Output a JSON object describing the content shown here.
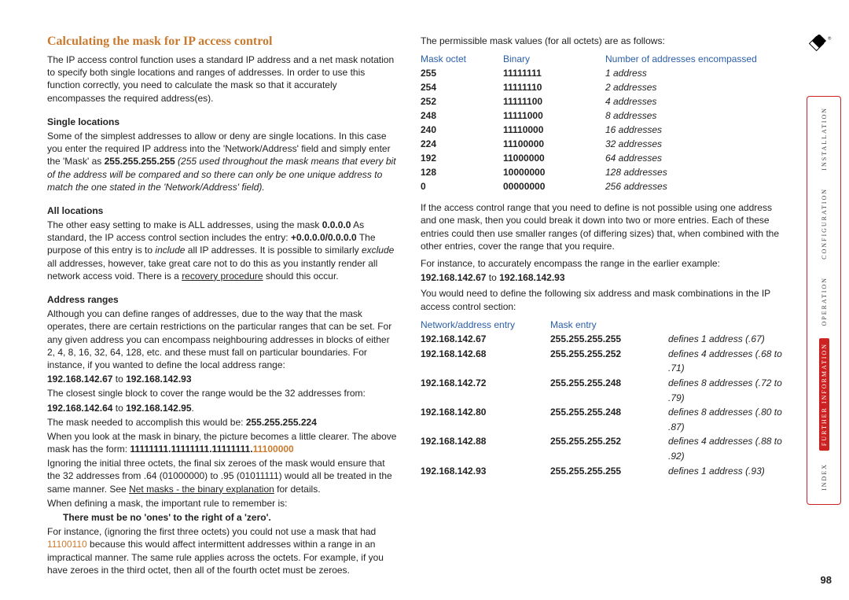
{
  "title": "Calculating the mask for IP access control",
  "pageNumber": "98",
  "intro": "The IP access control function uses a standard IP address and a net mask notation to specify both single locations and ranges of addresses. In order to use this function correctly, you need to calculate the mask so that it accurately encompasses the required address(es).",
  "single": {
    "head": "Single locations",
    "p1a": "Some of the simplest addresses to allow or deny are single locations. In this case you enter the required IP address into the 'Network/Address' field and simply enter the 'Mask' as ",
    "p1b": "255.255.255.255 ",
    "p1c": "(255 used throughout the mask means that every bit of the address will be compared and so there can only be one unique address to match the one stated in the 'Network/Address' field)."
  },
  "all": {
    "head": "All locations",
    "p1a": "The other easy setting to make is ALL addresses, using the mask ",
    "p1b": "0.0.0.0",
    "p1c": "  As standard, the IP access control section includes the entry: ",
    "p1d": "+0.0.0.0/0.0.0.0",
    "p1e": " The purpose of this entry is to ",
    "p1f": "include",
    "p1g": " all IP addresses. It is possible to similarly ",
    "p1h": "exclude",
    "p1i": " all addresses, however, take great care not to do this as you instantly render all network access void. There is a ",
    "p1j": "recovery procedure",
    "p1k": " should this occur."
  },
  "ranges": {
    "head": "Address ranges",
    "p1": "Although you can define ranges of addresses, due to the way that the mask operates, there are certain restrictions on the particular ranges that can be set. For any given address you can encompass neighbouring addresses in blocks of either 2, 4, 8, 16, 32, 64, 128, etc. and these must fall on particular boundaries. For instance, if you wanted to define the local address range:",
    "r1a": "192.168.142.67",
    "r1b": " to ",
    "r1c": "192.168.142.93",
    "p2": "The closest single block to cover the range would be the 32 addresses from:",
    "r2a": "192.168.142.64",
    "r2b": " to ",
    "r2c": "192.168.142.95",
    "r2d": ".",
    "p3a": "The mask needed to accomplish this would be: ",
    "p3b": "255.255.255.224",
    "p4a": "When you look at the mask in binary, the picture becomes a little clearer. The above mask has the form: ",
    "p4b": "11111111.11111111.11111111.",
    "p4c": "11100000",
    "p5a": "Ignoring the initial three octets, the final six zeroes of the mask would ensure that the 32 addresses from .64 (01000000) to .95 (01011111) would all be treated in the same manner. See ",
    "p5b": "Net masks - the binary explanation",
    "p5c": " for details.",
    "p6": "When defining a mask, the important rule to remember is:",
    "rule": "There must be no 'ones' to the right of a 'zero'.",
    "p7a": "For instance, (ignoring the first three octets) you could not use a mask that had ",
    "p7b": "11100110",
    "p7c": " because this would affect intermittent addresses within a range in an impractical manner. The same rule applies across the octets. For example, if you have zeroes in the third octet, then all of the fourth octet must be zeroes."
  },
  "perm": {
    "intro": "The permissible mask values (for all octets) are as follows:",
    "headers": {
      "c1": "Mask octet",
      "c2": "Binary",
      "c3": "Number of addresses encompassed"
    },
    "rows": [
      {
        "c1": "255",
        "c2": "11111111",
        "c3": "1 address"
      },
      {
        "c1": "254",
        "c2": "11111110",
        "c3": "2 addresses"
      },
      {
        "c1": "252",
        "c2": "11111100",
        "c3": "4 addresses"
      },
      {
        "c1": "248",
        "c2": "11111000",
        "c3": "8 addresses"
      },
      {
        "c1": "240",
        "c2": "11110000",
        "c3": "16 addresses"
      },
      {
        "c1": "224",
        "c2": "11100000",
        "c3": "32 addresses"
      },
      {
        "c1": "192",
        "c2": "11000000",
        "c3": "64 addresses"
      },
      {
        "c1": "128",
        "c2": "10000000",
        "c3": "128 addresses"
      },
      {
        "c1": "0",
        "c2": "00000000",
        "c3": "256 addresses"
      }
    ]
  },
  "combine": {
    "p1": "If the access control range that you need to define is not possible using one address and one mask, then you could break it down into two or more entries. Each of these entries could then use smaller ranges (of differing sizes) that, when combined with the other entries, cover the range that you require.",
    "p2": "For instance, to accurately encompass the range in the earlier example:",
    "r1a": "192.168.142.67",
    "r1b": " to ",
    "r1c": "192.168.142.93",
    "p3": "You would need to define the following six address and mask combinations in the IP access control section:",
    "headers": {
      "e1": "Network/address entry",
      "e2": "Mask entry"
    },
    "rows": [
      {
        "e1": "192.168.142.67",
        "e2": "255.255.255.255",
        "e3": "defines 1 address (.67)"
      },
      {
        "e1": "192.168.142.68",
        "e2": "255.255.255.252",
        "e3": "defines 4 addresses (.68 to .71)"
      },
      {
        "e1": "192.168.142.72",
        "e2": "255.255.255.248",
        "e3": "defines 8 addresses (.72 to .79)"
      },
      {
        "e1": "192.168.142.80",
        "e2": "255.255.255.248",
        "e3": "defines 8 addresses (.80 to .87)"
      },
      {
        "e1": "192.168.142.88",
        "e2": "255.255.255.252",
        "e3": "defines 4 addresses (.88 to .92)"
      },
      {
        "e1": "192.168.142.93",
        "e2": "255.255.255.255",
        "e3": "defines 1 address (.93)"
      }
    ]
  },
  "sidebar": {
    "items": [
      {
        "label": "INSTALLATION"
      },
      {
        "label": "CONFIGURATION"
      },
      {
        "label": "OPERATION"
      },
      {
        "label": "FURTHER INFORMATION"
      },
      {
        "label": "INDEX"
      }
    ]
  }
}
